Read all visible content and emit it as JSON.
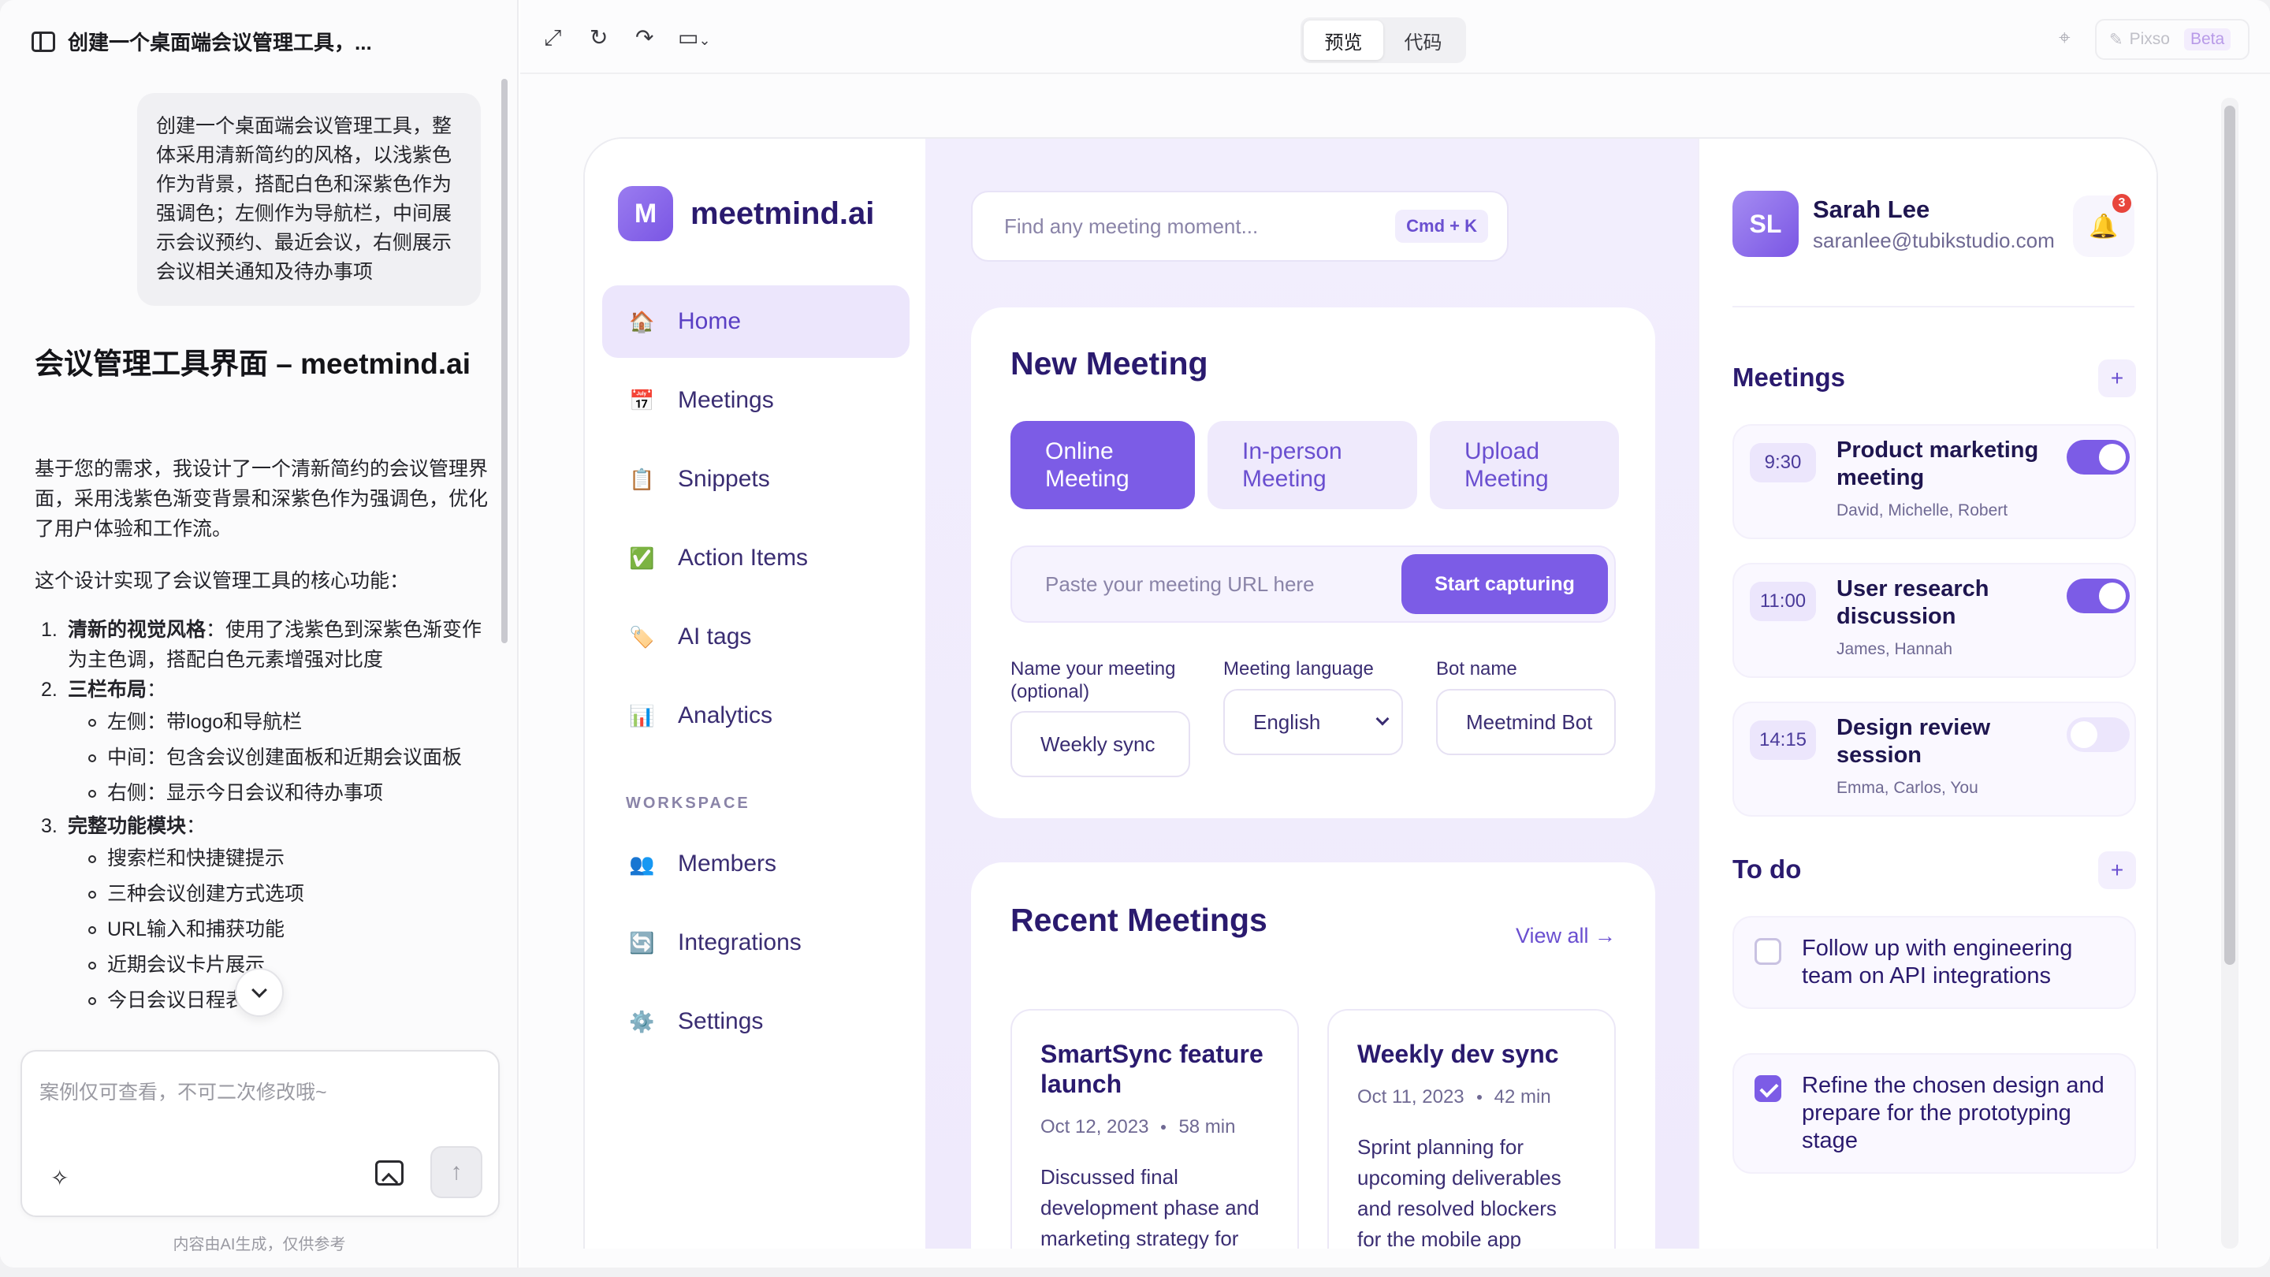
{
  "left_panel": {
    "title": "创建一个桌面端会议管理工具，...",
    "user_message": "创建一个桌面端会议管理工具，整体采用清新简约的风格，以浅紫色作为背景，搭配白色和深紫色作为强调色；左侧作为导航栏，中间展示会议预约、最近会议，右侧展示会议相关通知及待办事项",
    "ai_title": "会议管理工具界面 – meetmind.ai",
    "ai_intro": "基于您的需求，我设计了一个清新简约的会议管理界面，采用浅紫色渐变背景和深紫色作为强调色，优化了用户体验和工作流。",
    "ai_summary": "这个设计实现了会议管理工具的核心功能：",
    "list": {
      "item1_bold": "清新的视觉风格",
      "item1_rest": "：使用了浅紫色到深紫色渐变作为主色调，搭配白色元素增强对比度",
      "item2_bold": "三栏布局",
      "item2_rest": "：",
      "item2_sub1": "左侧：带logo和导航栏",
      "item2_sub2": "中间：包含会议创建面板和近期会议面板",
      "item2_sub3": "右侧：显示今日会议和待办事项",
      "item3_bold": "完整功能模块",
      "item3_rest": "：",
      "item3_sub1": "搜索栏和快捷键提示",
      "item3_sub2": "三种会议创建方式选项",
      "item3_sub3": "URL输入和捕获功能",
      "item3_sub4": "近期会议卡片展示",
      "item3_sub5": "今日会议日程表"
    },
    "composer_placeholder": "案例仅可查看，不可二次修改哦~",
    "disclaimer": "内容由AI生成，仅供参考"
  },
  "toolbar": {
    "preview_tab": "预览",
    "code_tab": "代码",
    "pixso_label": "Pixso",
    "beta_label": "Beta"
  },
  "app": {
    "logo_letter": "M",
    "logo_text": "meetmind.ai",
    "nav": [
      {
        "icon": "🏠",
        "label": "Home"
      },
      {
        "icon": "📅",
        "label": "Meetings"
      },
      {
        "icon": "📋",
        "label": "Snippets"
      },
      {
        "icon": "✅",
        "label": "Action Items"
      },
      {
        "icon": "🏷️",
        "label": "AI tags"
      },
      {
        "icon": "📊",
        "label": "Analytics"
      }
    ],
    "workspace_label": "WORKSPACE",
    "workspace_nav": [
      {
        "icon": "👥",
        "label": "Members"
      },
      {
        "icon": "🔄",
        "label": "Integrations"
      },
      {
        "icon": "⚙️",
        "label": "Settings"
      }
    ],
    "search": {
      "placeholder": "Find any meeting moment...",
      "shortcut": "Cmd + K"
    },
    "new_meeting": {
      "title": "New Meeting",
      "tabs": [
        "Online Meeting",
        "In-person Meeting",
        "Upload Meeting"
      ],
      "url_placeholder": "Paste your meeting URL here",
      "capture_label": "Start capturing",
      "name_label": "Name your meeting (optional)",
      "name_value": "Weekly sync",
      "language_label": "Meeting language",
      "language_value": "English",
      "bot_label": "Bot name",
      "bot_value": "Meetmind Bot"
    },
    "recent": {
      "title": "Recent Meetings",
      "view_all": "View all →",
      "items": [
        {
          "title": "SmartSync feature launch",
          "date": "Oct 12, 2023",
          "duration": "58 min",
          "desc": "Discussed final development phase and marketing strategy for"
        },
        {
          "title": "Weekly dev sync",
          "date": "Oct 11, 2023",
          "duration": "42 min",
          "desc": "Sprint planning for upcoming deliverables and resolved blockers for the mobile app"
        }
      ]
    },
    "profile": {
      "initials": "SL",
      "name": "Sarah Lee",
      "email": "saranlee@tubikstudio.com",
      "notifications": "3"
    },
    "meetings": {
      "title": "Meetings",
      "items": [
        {
          "time": "9:30",
          "title": "Product marketing meeting",
          "people": "David, Michelle, Robert",
          "enabled": true
        },
        {
          "time": "11:00",
          "title": "User research discussion",
          "people": "James, Hannah",
          "enabled": true
        },
        {
          "time": "14:15",
          "title": "Design review session",
          "people": "Emma, Carlos, You",
          "enabled": false
        }
      ]
    },
    "todo": {
      "title": "To do",
      "items": [
        {
          "text": "Follow up with engineering team on API integrations",
          "done": false
        },
        {
          "text": "Refine the chosen design and prepare for the prototyping stage",
          "done": true
        }
      ]
    }
  }
}
